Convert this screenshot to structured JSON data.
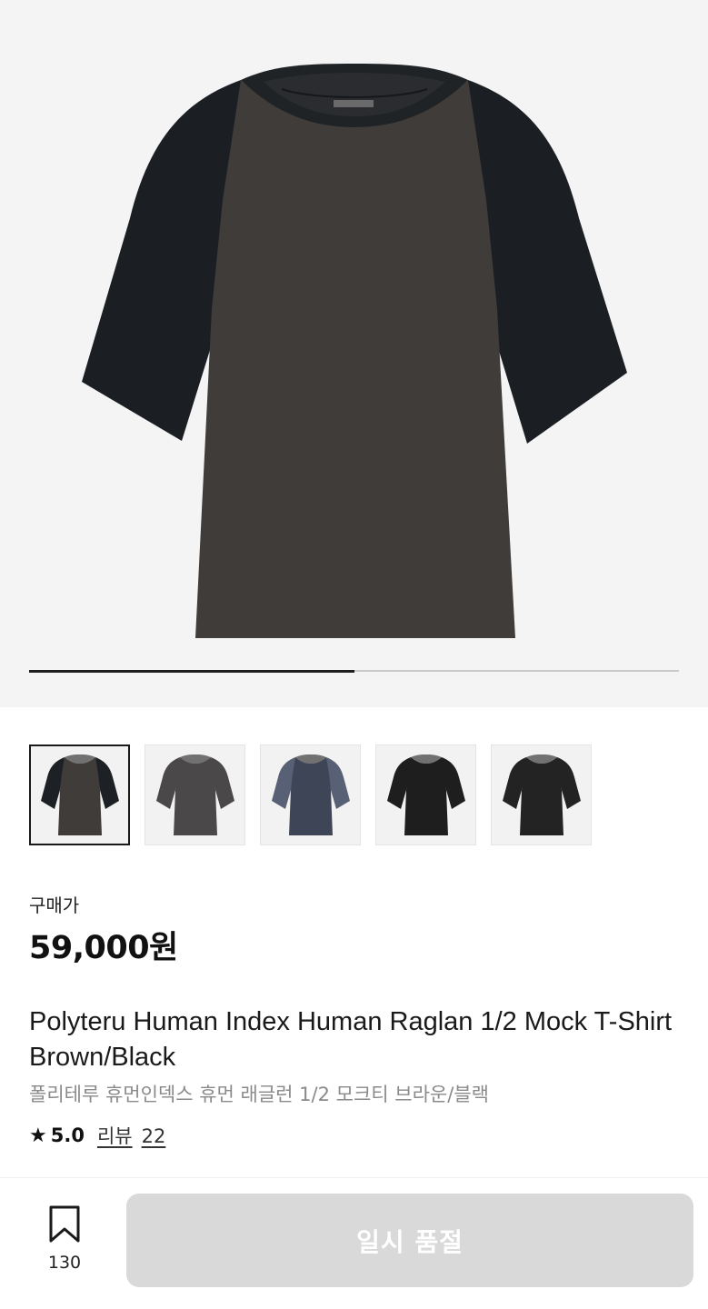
{
  "gallery": {
    "image_alt": "raglan-tshirt-product-photo",
    "progress": 0.5,
    "thumbnails": [
      {
        "name": "brown-black-raglan",
        "body_color": "#3f3c3a",
        "sleeve_color": "#1d2126",
        "selected": true
      },
      {
        "name": "charcoal-tee",
        "body_color": "#4a4848",
        "sleeve_color": "#4a4848",
        "selected": false
      },
      {
        "name": "navy-gray-tee",
        "body_color": "#3d4556",
        "sleeve_color": "#576074",
        "selected": false
      },
      {
        "name": "black-tee",
        "body_color": "#1e1e1e",
        "sleeve_color": "#1e1e1e",
        "selected": false
      },
      {
        "name": "black-tee-2",
        "body_color": "#232323",
        "sleeve_color": "#232323",
        "selected": false
      }
    ]
  },
  "product": {
    "price_label": "구매가",
    "price": "59,000원",
    "title_en": "Polyteru Human Index Human Raglan 1/2 Mock T-Shirt Brown/Black",
    "title_ko": "폴리테루 휴먼인덱스 휴먼 래글런 1/2 모크티 브라운/블랙",
    "rating_icon": "★",
    "rating": "5.0",
    "reviews_label": "리뷰",
    "reviews_count": "22"
  },
  "bottom_bar": {
    "bookmark_icon": "bookmark-icon",
    "bookmark_count": "130",
    "cta_label": "일시 품절"
  },
  "colors": {
    "accent": "#1e1e1e",
    "button_disabled": "#d9d9d9"
  }
}
